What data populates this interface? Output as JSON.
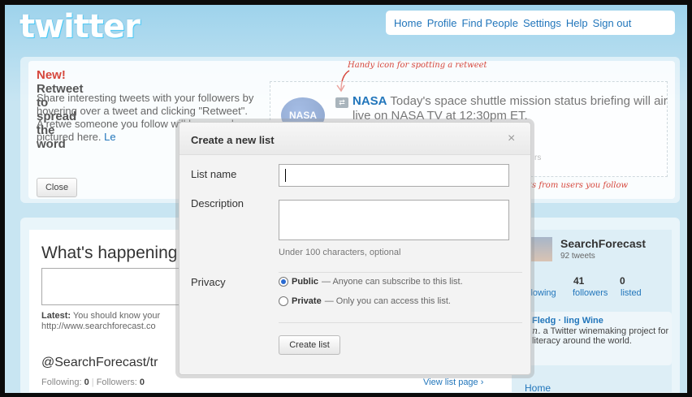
{
  "header": {
    "logo": "twitter",
    "nav": [
      "Home",
      "Profile",
      "Find People",
      "Settings",
      "Help",
      "Sign out"
    ]
  },
  "promo": {
    "title_new": "New!",
    "title_rest": " Retweet to spread the word",
    "body": "Share interesting tweets with your followers by hovering over a tweet and clicking \"Retweet\". A retwe someone you follow will lo example pictured here. ",
    "body_link": "Le",
    "close_label": "Close",
    "annotation_icon": "Handy icon for spotting a retweet",
    "annotation_follow": "ts from users you follow",
    "example_tweet": {
      "avatar_text": "NASA",
      "user": "NASA",
      "text": " Today's space shuttle mission status briefing will air live on NASA TV at 12:30pm ET.",
      "faded": "rs"
    }
  },
  "main": {
    "whats_happening": "What's happening",
    "latest_label": "Latest:",
    "latest_text": " You should know your http://www.searchforecast.co",
    "list_title": "@SearchForecast/tr",
    "following_label": "Following:",
    "following_value": "0",
    "followers_label": "Followers:",
    "followers_value": "0",
    "view_list": "View list page ›"
  },
  "sidebar": {
    "name": "SearchForecast",
    "tweets": "92 tweets",
    "following_count": "",
    "followers_count": "41",
    "listed_count": "0",
    "following_label": "llowing",
    "followers_label": "followers",
    "listed_label": "listed",
    "card_title": "Fledg · ling Wine",
    "card_body_italic": "n.",
    "card_body": " a Twitter winemaking project for literacy around the world.",
    "home": "Home"
  },
  "modal": {
    "title": "Create a new list",
    "close_glyph": "×",
    "list_name_label": "List name",
    "list_name_value": "",
    "description_label": "Description",
    "description_hint": "Under 100 characters, optional",
    "privacy_label": "Privacy",
    "public_label": "Public",
    "public_desc": " — Anyone can subscribe to this list.",
    "private_label": "Private",
    "private_desc": " — Only you can access this list.",
    "selected_privacy": "Public",
    "create_label": "Create list"
  },
  "icons": {
    "retweet": "retweet-icon",
    "close": "close-icon",
    "arrow": "annotation-arrow-icon"
  },
  "colors": {
    "link": "#2276bb",
    "accent_red": "#d6473c",
    "background": "#c0deed"
  }
}
